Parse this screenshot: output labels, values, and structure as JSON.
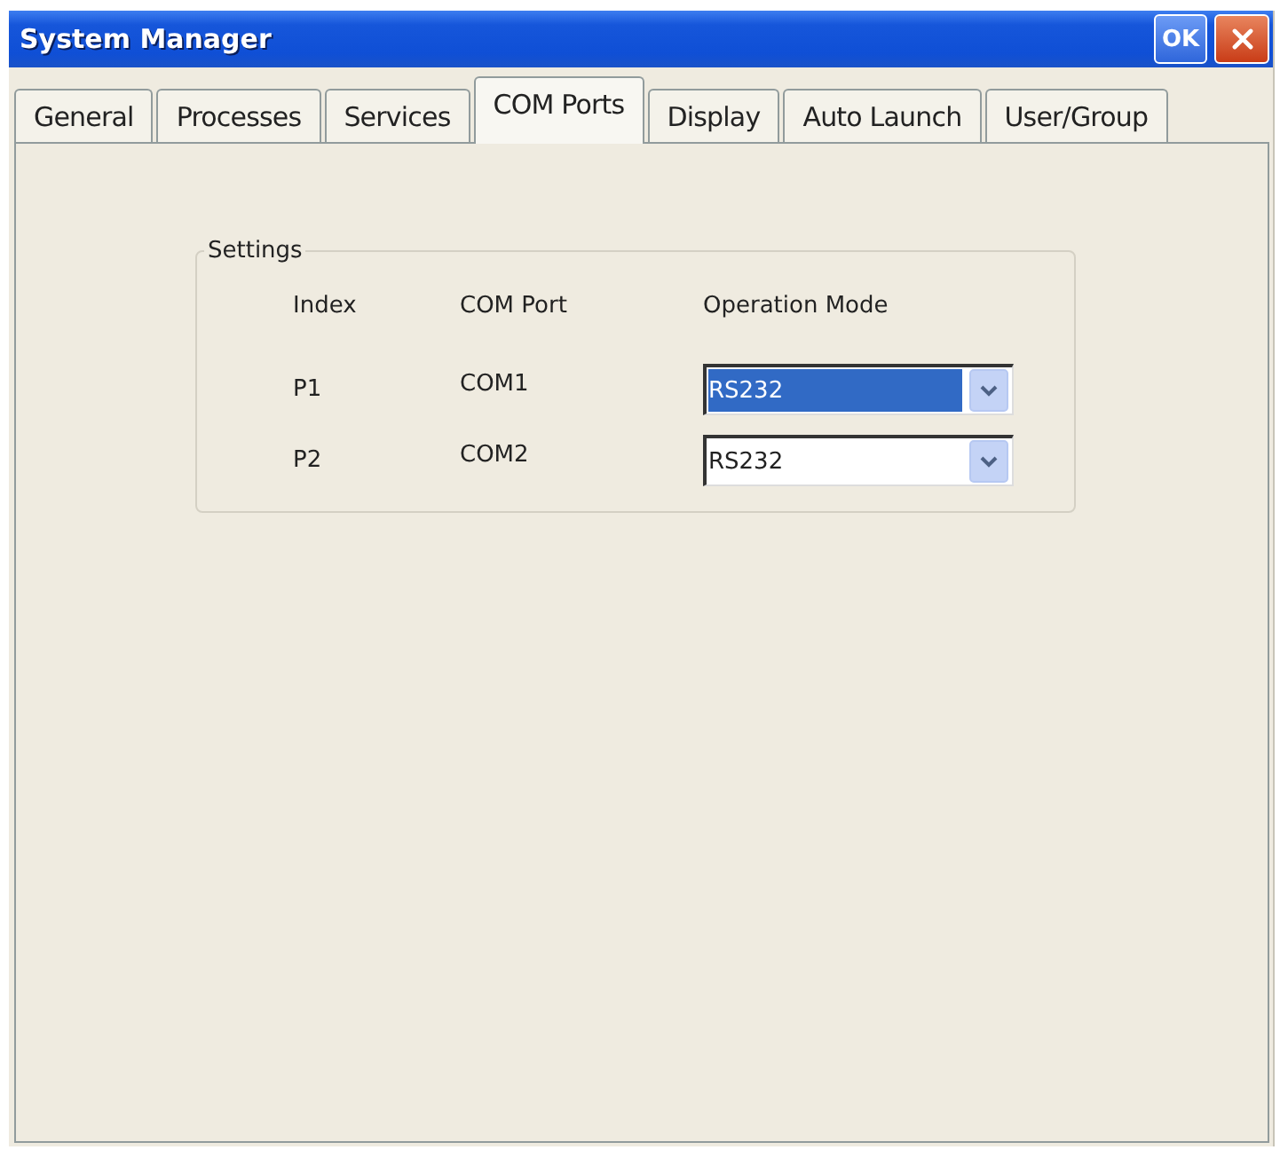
{
  "window": {
    "title": "System Manager",
    "ok_button": {
      "label": "OK"
    }
  },
  "tabs": [
    {
      "label": "General",
      "selected": false
    },
    {
      "label": "Processes",
      "selected": false
    },
    {
      "label": "Services",
      "selected": false
    },
    {
      "label": "COM Ports",
      "selected": true
    },
    {
      "label": "Display",
      "selected": false
    },
    {
      "label": "Auto Launch",
      "selected": false
    },
    {
      "label": "User/Group",
      "selected": false
    }
  ],
  "settings": {
    "title": "Settings",
    "columns": [
      "Index",
      "COM Port",
      "Operation Mode"
    ],
    "rows": [
      {
        "index": "P1",
        "com_port": "COM1",
        "mode": "RS232",
        "focused": true
      },
      {
        "index": "P2",
        "com_port": "COM2",
        "mode": "RS232",
        "focused": false
      }
    ]
  }
}
